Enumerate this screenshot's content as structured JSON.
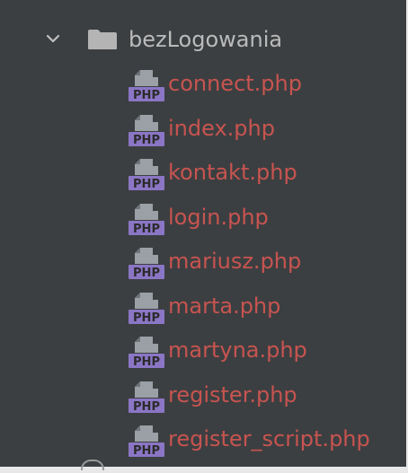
{
  "project_tree": {
    "folder": {
      "name": "bezLogowania",
      "expanded": true,
      "icon": "folder-icon",
      "chevron_icon": "chevron-down-icon"
    },
    "files": [
      {
        "name": "connect.php"
      },
      {
        "name": "index.php"
      },
      {
        "name": "kontakt.php"
      },
      {
        "name": "login.php"
      },
      {
        "name": "mariusz.php"
      },
      {
        "name": "marta.php"
      },
      {
        "name": "martyna.php"
      },
      {
        "name": "register.php"
      },
      {
        "name": "register_script.php"
      }
    ],
    "file_icon": "php-file-icon",
    "file_icon_label": "PHP"
  },
  "colors": {
    "background": "#3c3f41",
    "folder_text": "#bbbbbb",
    "file_text_error": "#c75450",
    "php_badge": "#8b76c5",
    "file_icon_gray": "#9aa0a6"
  }
}
